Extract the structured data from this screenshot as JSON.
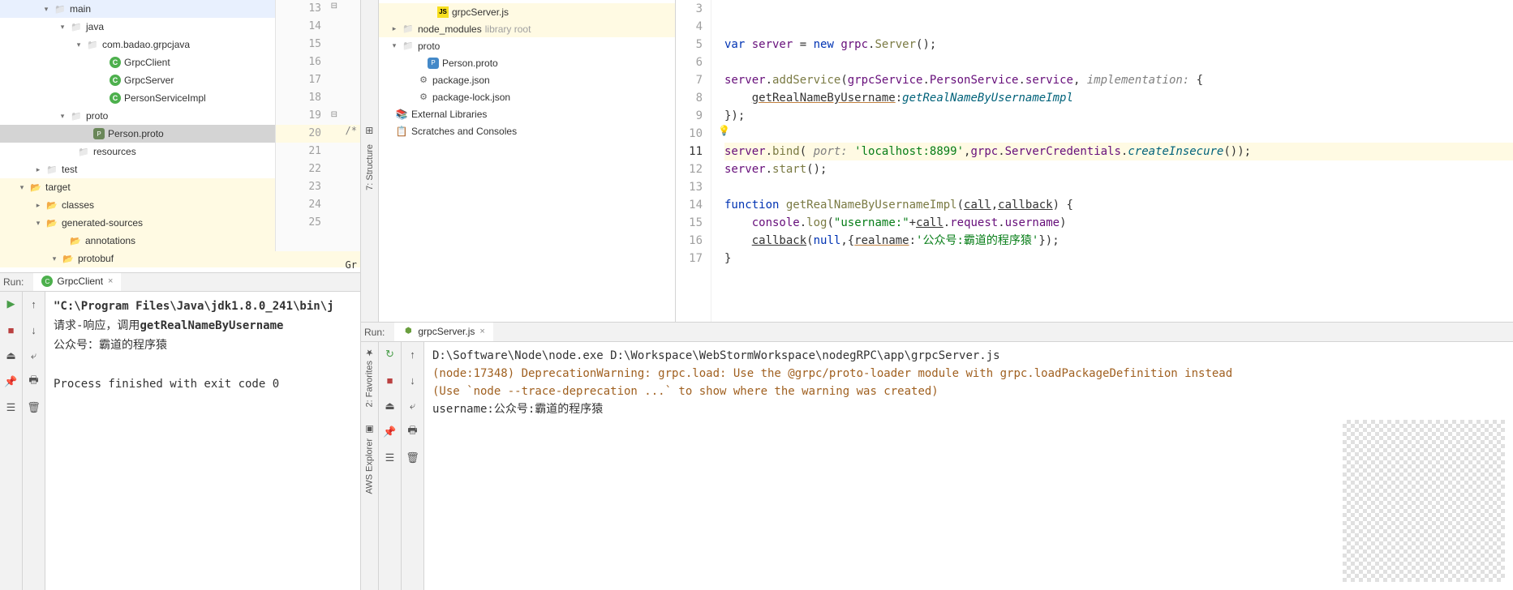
{
  "left_tree": [
    {
      "indent": 48,
      "arrow": "▾",
      "iconType": "folder",
      "label": "main"
    },
    {
      "indent": 68,
      "arrow": "▾",
      "iconType": "folder",
      "label": "java"
    },
    {
      "indent": 88,
      "arrow": "▾",
      "iconType": "folder",
      "label": "com.badao.grpcjava"
    },
    {
      "indent": 117,
      "arrow": "",
      "iconType": "java-c",
      "label": "GrpcClient"
    },
    {
      "indent": 117,
      "arrow": "",
      "iconType": "java-c",
      "label": "GrpcServer"
    },
    {
      "indent": 117,
      "arrow": "",
      "iconType": "java-c",
      "label": "PersonServiceImpl"
    },
    {
      "indent": 68,
      "arrow": "▾",
      "iconType": "folder",
      "label": "proto"
    },
    {
      "indent": 97,
      "arrow": "",
      "iconType": "proto",
      "label": "Person.proto",
      "sel": true
    },
    {
      "indent": 77,
      "arrow": "",
      "iconType": "folder",
      "label": "resources"
    },
    {
      "indent": 38,
      "arrow": "▸",
      "iconType": "folder",
      "label": "test"
    },
    {
      "indent": 18,
      "arrow": "▾",
      "iconType": "folder-o",
      "label": "target",
      "bg": true
    },
    {
      "indent": 38,
      "arrow": "▸",
      "iconType": "folder-o",
      "label": "classes",
      "bg": true
    },
    {
      "indent": 38,
      "arrow": "▾",
      "iconType": "folder-o",
      "label": "generated-sources",
      "bg": true
    },
    {
      "indent": 67,
      "arrow": "",
      "iconType": "folder-o",
      "label": "annotations",
      "bg": true
    },
    {
      "indent": 58,
      "arrow": "▾",
      "iconType": "folder-o",
      "label": "protobuf",
      "bg": true
    }
  ],
  "left_gutter": [
    "13",
    "14",
    "15",
    "16",
    "17",
    "18",
    "19",
    "20",
    "21",
    "22",
    "23",
    "24",
    "25"
  ],
  "left_code_comment": "/*",
  "grpc_text": "Gr",
  "left_run": {
    "label": "Run:",
    "tab": "GrpcClient",
    "lines": {
      "cmd": "\"C:\\Program Files\\Java\\jdk1.8.0_241\\bin\\j",
      "l1a": "请求-响应，调用",
      "l1b": "getRealNameByUsername",
      "l2": "公众号：霸道的程序猿",
      "exit": "Process finished with exit code 0"
    }
  },
  "structure_label": "7: Structure",
  "second_tree": [
    {
      "indent": 54,
      "arrow": "",
      "iconType": "js",
      "label": "grpcServer.js",
      "hl": true
    },
    {
      "indent": 10,
      "arrow": "▸",
      "iconType": "folder",
      "label": "node_modules",
      "hint": "library root",
      "hl": true
    },
    {
      "indent": 10,
      "arrow": "▾",
      "iconType": "folder",
      "label": "proto"
    },
    {
      "indent": 42,
      "arrow": "",
      "iconType": "pp",
      "label": "Person.proto"
    },
    {
      "indent": 30,
      "arrow": "",
      "iconType": "json",
      "label": "package.json"
    },
    {
      "indent": 30,
      "arrow": "",
      "iconType": "json",
      "label": "package-lock.json"
    },
    {
      "indent": 2,
      "arrow": "",
      "iconType": "lib",
      "label": "External Libraries"
    },
    {
      "indent": 2,
      "arrow": "",
      "iconType": "scratch",
      "label": "Scratches and Consoles"
    }
  ],
  "editor": {
    "gutter": [
      "3",
      "4",
      "5",
      "6",
      "7",
      "8",
      "9",
      "10",
      "11",
      "12",
      "13",
      "14",
      "15",
      "16",
      "17"
    ],
    "current_line": 11,
    "lines": [
      {
        "n": 3,
        "spans": []
      },
      {
        "n": 4,
        "spans": []
      },
      {
        "n": 5,
        "spans": [
          {
            "t": "var ",
            "c": "kw"
          },
          {
            "t": "server",
            "c": "var"
          },
          {
            "t": " = "
          },
          {
            "t": "new ",
            "c": "kw"
          },
          {
            "t": "grpc",
            "c": "var"
          },
          {
            "t": "."
          },
          {
            "t": "Server",
            "c": "fn"
          },
          {
            "t": "();"
          }
        ]
      },
      {
        "n": 6,
        "spans": []
      },
      {
        "n": 7,
        "spans": [
          {
            "t": "server",
            "c": "var"
          },
          {
            "t": "."
          },
          {
            "t": "addService",
            "c": "fn"
          },
          {
            "t": "("
          },
          {
            "t": "grpcService",
            "c": "var"
          },
          {
            "t": "."
          },
          {
            "t": "PersonService",
            "c": "var"
          },
          {
            "t": "."
          },
          {
            "t": "service",
            "c": "var"
          },
          {
            "t": ", "
          },
          {
            "t": "implementation: ",
            "c": "param"
          },
          {
            "t": "{"
          }
        ]
      },
      {
        "n": 8,
        "spans": [
          {
            "t": "    "
          },
          {
            "t": "getRealNameByUsername",
            "c": "orange-und"
          },
          {
            "t": ":"
          },
          {
            "t": "getRealNameByUsernameImpl",
            "c": "fni"
          }
        ]
      },
      {
        "n": 9,
        "spans": [
          {
            "t": "});"
          }
        ]
      },
      {
        "n": 10,
        "spans": []
      },
      {
        "n": 11,
        "hl": true,
        "spans": [
          {
            "t": "server",
            "c": "var"
          },
          {
            "t": "."
          },
          {
            "t": "bind",
            "c": "fn"
          },
          {
            "t": "( "
          },
          {
            "t": "port: ",
            "c": "param"
          },
          {
            "t": "'localhost:8899'",
            "c": "str"
          },
          {
            "t": ","
          },
          {
            "t": "grpc",
            "c": "var"
          },
          {
            "t": "."
          },
          {
            "t": "ServerCredentials",
            "c": "var"
          },
          {
            "t": "."
          },
          {
            "t": "createInsecure",
            "c": "fni"
          },
          {
            "t": "());"
          }
        ]
      },
      {
        "n": 12,
        "spans": [
          {
            "t": "server",
            "c": "var"
          },
          {
            "t": "."
          },
          {
            "t": "start",
            "c": "fn"
          },
          {
            "t": "();"
          }
        ]
      },
      {
        "n": 13,
        "spans": []
      },
      {
        "n": 14,
        "spans": [
          {
            "t": "function ",
            "c": "kw"
          },
          {
            "t": "getRealNameByUsernameImpl",
            "c": "fn"
          },
          {
            "t": "("
          },
          {
            "t": "call",
            "c": "under"
          },
          {
            "t": ","
          },
          {
            "t": "callback",
            "c": "under"
          },
          {
            "t": ") {"
          }
        ]
      },
      {
        "n": 15,
        "spans": [
          {
            "t": "    "
          },
          {
            "t": "console",
            "c": "var"
          },
          {
            "t": "."
          },
          {
            "t": "log",
            "c": "fn"
          },
          {
            "t": "("
          },
          {
            "t": "\"username:\"",
            "c": "str"
          },
          {
            "t": "+"
          },
          {
            "t": "call",
            "c": "under"
          },
          {
            "t": "."
          },
          {
            "t": "request",
            "c": "var"
          },
          {
            "t": "."
          },
          {
            "t": "username",
            "c": "var"
          },
          {
            "t": ")"
          }
        ]
      },
      {
        "n": 16,
        "spans": [
          {
            "t": "    "
          },
          {
            "t": "callback",
            "c": "under"
          },
          {
            "t": "("
          },
          {
            "t": "null",
            "c": "kw"
          },
          {
            "t": ",{"
          },
          {
            "t": "realname",
            "c": "orange-und"
          },
          {
            "t": ":"
          },
          {
            "t": "'公众号:霸道的程序猿'",
            "c": "str"
          },
          {
            "t": "});"
          }
        ]
      },
      {
        "n": 17,
        "spans": [
          {
            "t": "}"
          }
        ]
      }
    ]
  },
  "favorites_label": "2: Favorites",
  "aws_label": "AWS Explorer",
  "right_run": {
    "label": "Run:",
    "tab": "grpcServer.js",
    "lines": [
      {
        "t": "D:\\Software\\Node\\node.exe D:\\Workspace\\WebStormWorkspace\\nodegRPC\\app\\grpcServer.js",
        "c": ""
      },
      {
        "t": "(node:17348) DeprecationWarning: grpc.load: Use the @grpc/proto-loader module with grpc.loadPackageDefinition instead",
        "c": "warn"
      },
      {
        "t": "(Use `node --trace-deprecation ...` to show where the warning was created)",
        "c": "warn"
      },
      {
        "t": "username:公众号:霸道的程序猿",
        "c": ""
      }
    ]
  }
}
